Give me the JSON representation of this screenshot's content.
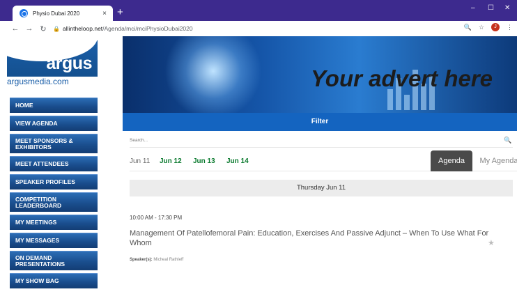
{
  "browser": {
    "tab_title": "Physio Dubai 2020",
    "tab_close": "×",
    "new_tab": "+",
    "url_host": "allintheloop.net",
    "url_path": "/Agenda/mci/mciPhysioDubai2020",
    "avatar_letter": "J",
    "controls": {
      "minimize": "–",
      "maximize": "☐",
      "close": "✕"
    }
  },
  "sidebar": {
    "logo_text": "argus",
    "site_name": "argusmedia.com",
    "menu": [
      "HOME",
      "VIEW AGENDA",
      "MEET SPONSORS & EXHIBITORS",
      "MEET ATTENDEES",
      "SPEAKER PROFILES",
      "COMPETITION LEADERBOARD",
      "MY MEETINGS",
      "MY MESSAGES",
      "ON DEMAND PRESENTATIONS",
      "MY SHOW BAG"
    ]
  },
  "banner": {
    "text": "Your advert here"
  },
  "filter": {
    "label": "Filter"
  },
  "search": {
    "placeholder": "Search..."
  },
  "dates": [
    "Jun 11",
    "Jun 12",
    "Jun 13",
    "Jun 14"
  ],
  "tabs": {
    "agenda": "Agenda",
    "my_agenda": "My Agenda"
  },
  "day_header": "Thursday Jun 11",
  "session": {
    "time": "10:00 AM - 17:30 PM",
    "title": "Management Of Patellofemoral Pain: Education, Exercises And Passive Adjunct – When To Use What For Whom",
    "speakers_label": "Speaker(s):",
    "speakers": "Micheal Rathleff"
  },
  "colors": {
    "accent_blue": "#1464c0",
    "date_green": "#0a7a2e",
    "desktop_purple": "#3d2a8e"
  }
}
